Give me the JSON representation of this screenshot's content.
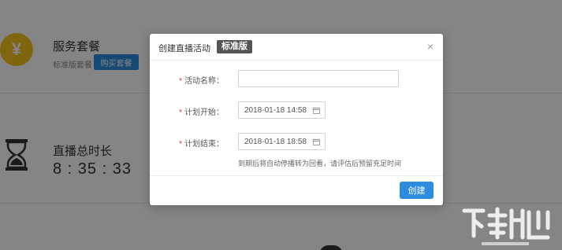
{
  "background": {
    "service": {
      "icon": "yen-coin-icon",
      "symbol": "¥",
      "title": "服务套餐",
      "tier": "标准版套餐",
      "buy_label": "购买套餐"
    },
    "duration": {
      "icon": "hourglass-icon",
      "title": "直播总时长",
      "value": "8 : 35 : 33"
    }
  },
  "dialog": {
    "title": "创建直播活动",
    "edition_tag": "标准版",
    "close_symbol": "×",
    "fields": {
      "name": {
        "required_mark": "*",
        "label": "活动名称：",
        "value": ""
      },
      "start": {
        "required_mark": "*",
        "label": "计划开始：",
        "value": "2018-01-18 14:58"
      },
      "end": {
        "required_mark": "*",
        "label": "计划结束：",
        "value": "2018-01-18 18:58"
      }
    },
    "hint": "到期后将自动停播转为回看，请评估后预留充足时间",
    "create_label": "创建"
  },
  "colors": {
    "primary": "#2d8ce0",
    "required": "#e03b2f",
    "coin": "#f1c21b",
    "overlay": "rgba(0,0,0,0.48)"
  }
}
